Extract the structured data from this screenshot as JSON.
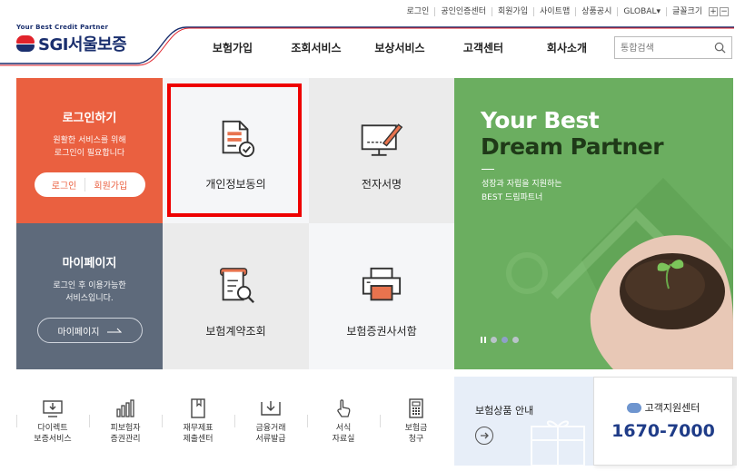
{
  "header": {
    "util_links": [
      "로그인",
      "공인인증센터",
      "회원가입",
      "사이트맵",
      "상품공시",
      "GLOBAL▾"
    ],
    "font_size_label": "글꼴크기",
    "font_plus": "+",
    "font_minus": "−",
    "logo_tag": "Your Best Credit Partner",
    "logo_name": "SGI서울보증",
    "nav": [
      "보험가입",
      "조회서비스",
      "보상서비스",
      "고객센터",
      "회사소개"
    ],
    "search_placeholder": "통합검색"
  },
  "login_tile": {
    "title": "로그인하기",
    "desc_line1": "원활한 서비스를 위해",
    "desc_line2": "로그인이 필요합니다",
    "login_label": "로그인",
    "join_label": "회원가입"
  },
  "mypage_tile": {
    "title": "마이페이지",
    "desc_line1": "로그인 후 이용가능한",
    "desc_line2": "서비스입니다.",
    "button_label": "마이페이지"
  },
  "service_tiles": {
    "privacy": "개인정보동의",
    "esign": "전자서명",
    "contract": "보험계약조회",
    "policy": "보험증권사서함"
  },
  "banner": {
    "headline1": "Your Best",
    "headline2": "Dream Partner",
    "sub_line1": "성장과 자립을 지원하는",
    "sub_line2": "BEST 드림파트너",
    "active_slide": 2,
    "slide_count": 3
  },
  "quick_menu": [
    {
      "line1": "다이렉트",
      "line2": "보증서비스",
      "icon": "download-monitor-icon"
    },
    {
      "line1": "피보험자",
      "line2": "증권관리",
      "icon": "bar-chart-icon"
    },
    {
      "line1": "재무제표",
      "line2": "제출센터",
      "icon": "document-icon"
    },
    {
      "line1": "금융거래",
      "line2": "서류발급",
      "icon": "tray-download-icon"
    },
    {
      "line1": "서식",
      "line2": "자료실",
      "icon": "hand-pointer-icon"
    },
    {
      "line1": "보험금",
      "line2": "청구",
      "icon": "calculator-icon"
    }
  ],
  "product_guide": {
    "title": "보험상품 안내"
  },
  "customer_center": {
    "title": "고객지원센터",
    "phone": "1670-7000"
  },
  "colors": {
    "brand_navy": "#1a2f6e",
    "brand_red": "#e1232b",
    "login_orange": "#ea6040",
    "mypage_slate": "#5e6a7b",
    "banner_green": "#6bae60",
    "highlight_red": "#ee0000"
  }
}
